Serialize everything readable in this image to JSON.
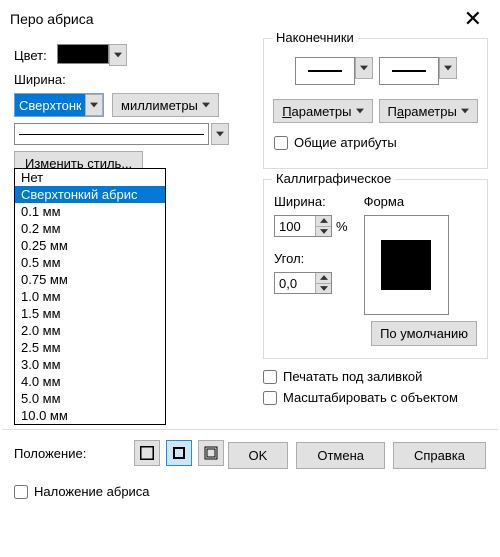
{
  "title": "Перо абриса",
  "labels": {
    "color": "Цвет:",
    "width": "Ширина:",
    "units": "миллиметры",
    "edit_style": "Изменить стиль...",
    "arrowheads": "Наконечники",
    "params": "Параметры",
    "shared_attrs": "Общие атрибуты",
    "calligraphic": "Каллиграфическое",
    "cal_width": "Ширина:",
    "cal_shape": "Форма",
    "cal_angle": "Угол:",
    "default_btn": "По умолчанию",
    "print_under": "Печатать под заливкой",
    "scale_with": "Масштабировать с объектом",
    "overlay": "Наложение абриса",
    "position": "Положение:",
    "ok": "OK",
    "cancel": "Отмена",
    "help": "Справка",
    "percent": "%"
  },
  "width_combo": {
    "value": "Сверхтонк"
  },
  "dropdown_items": [
    "Нет",
    "Сверхтонкий абрис",
    "0.1 мм",
    "0.2 мм",
    "0.25 мм",
    "0.5 мм",
    "0.75 мм",
    "1.0 мм",
    "1.5 мм",
    "2.0 мм",
    "2.5 мм",
    "3.0 мм",
    "4.0 мм",
    "5.0 мм",
    "10.0 мм"
  ],
  "dropdown_selected_index": 1,
  "cal": {
    "width": "100",
    "angle": "0,0"
  }
}
